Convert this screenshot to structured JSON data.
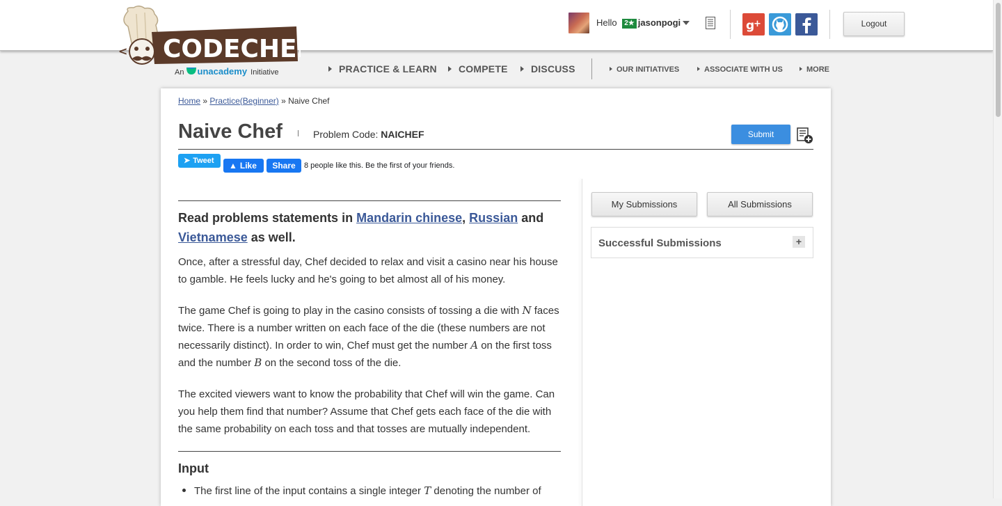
{
  "header": {
    "logo_text": "CODECHEF",
    "tagline_prefix": "An",
    "tagline_brand": "unacademy",
    "tagline_suffix": "Initiative",
    "greeting": "Hello",
    "star_badge": "2★",
    "username": "jasonpogi",
    "logout_label": "Logout"
  },
  "nav": {
    "main": [
      "PRACTICE & LEARN",
      "COMPETE",
      "DISCUSS"
    ],
    "secondary": [
      "OUR INITIATIVES",
      "ASSOCIATE WITH US",
      "MORE"
    ]
  },
  "breadcrumb": {
    "home": "Home",
    "sep1": "»",
    "practice": "Practice(Beginner)",
    "sep2": "»",
    "current": "Naive Chef"
  },
  "problem": {
    "title": "Naive Chef",
    "code_label": "Problem Code:",
    "code": "NAICHEF",
    "submit_label": "Submit"
  },
  "social": {
    "tweet_label": "Tweet",
    "like_label": "Like",
    "share_label": "Share",
    "like_count_text": "8 people like this. Be the first of your friends."
  },
  "statement": {
    "lang_prefix": "Read problems statements in",
    "lang_1": "Mandarin chinese",
    "comma": ",",
    "lang_2": "Russian",
    "and": "and",
    "lang_3": "Vietnamese",
    "lang_suffix": "as well.",
    "p1": "Once, after a stressful day, Chef decided to relax and visit a casino near his house to gamble. He feels lucky and he's going to bet almost all of his money.",
    "p2_a": "The game Chef is going to play in the casino consists of tossing a die with",
    "p2_var_n": "N",
    "p2_b": "faces twice. There is a number written on each face of the die (these numbers are not necessarily distinct). In order to win, Chef must get the number",
    "p2_var_a": "A",
    "p2_c": "on the first toss and the number",
    "p2_var_b": "B",
    "p2_d": "on the second toss of the die.",
    "p3": "The excited viewers want to know the probability that Chef will win the game. Can you help them find that number? Assume that Chef gets each face of the die with the same probability on each toss and that tosses are mutually independent.",
    "input_heading": "Input",
    "bullet_1_a": "The first line of the input contains a single integer",
    "bullet_1_var": "T",
    "bullet_1_b": "denoting the number of"
  },
  "sidebar": {
    "my_submissions": "My Submissions",
    "all_submissions": "All Submissions",
    "successful_submissions": "Successful Submissions",
    "expand_symbol": "+"
  },
  "colors": {
    "brand_brown": "#5b3a29",
    "link_blue": "#3b5998",
    "submit_blue": "#3b8ee0",
    "tweet_blue": "#1da1f2",
    "fb_blue": "#1877f2"
  }
}
